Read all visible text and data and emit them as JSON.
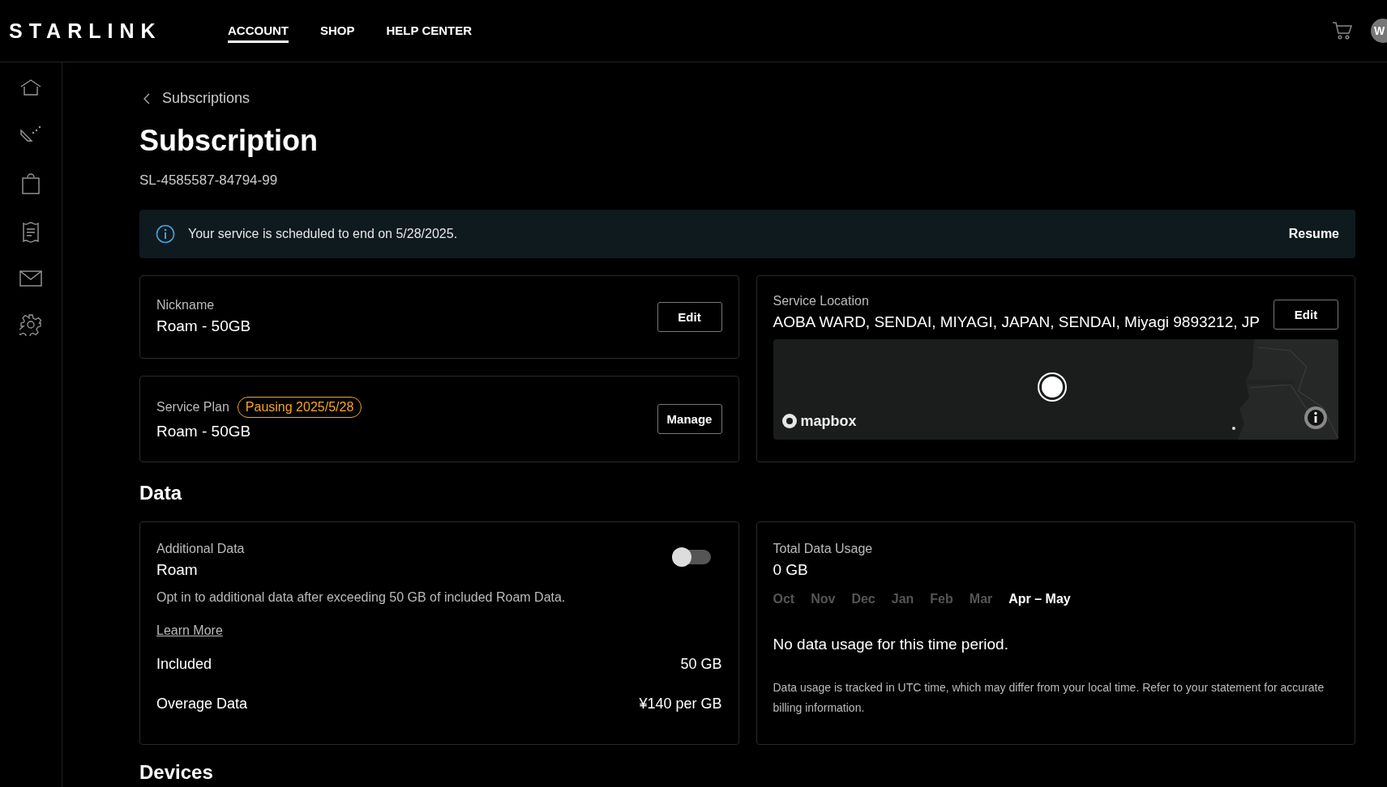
{
  "header": {
    "logo": "STARLINK",
    "nav": [
      {
        "label": "ACCOUNT",
        "selected": true
      },
      {
        "label": "SHOP",
        "selected": false
      },
      {
        "label": "HELP CENTER",
        "selected": false
      }
    ],
    "avatar": "W"
  },
  "breadcrumb": "Subscriptions",
  "title": "Subscription",
  "subscription_id": "SL-4585587-84794-99",
  "banner": {
    "message": "Your service is scheduled to end on 5/28/2025.",
    "action": "Resume"
  },
  "nickname": {
    "label": "Nickname",
    "value": "Roam - 50GB",
    "button": "Edit"
  },
  "service_plan": {
    "label": "Service Plan",
    "badge": "Pausing 2025/5/28",
    "value": "Roam - 50GB",
    "button": "Manage"
  },
  "service_location": {
    "label": "Service Location",
    "value": "AOBA WARD, SENDAI, MIYAGI, JAPAN, SENDAI, Miyagi 9893212, JP",
    "button": "Edit",
    "map": {
      "kind": "picture",
      "attribution": "mapbox"
    }
  },
  "data_heading": "Data",
  "additional_data": {
    "label": "Additional Data",
    "value": "Roam",
    "on": false,
    "description": "Opt in to additional data after exceeding 50 GB of included Roam Data.",
    "link": "Learn More",
    "rows": [
      {
        "label": "Included",
        "value": "50 GB"
      },
      {
        "label": "Overage Data",
        "value": "¥140 per GB"
      }
    ]
  },
  "usage": {
    "label": "Total Data Usage",
    "value": "0 GB",
    "periods": [
      {
        "label": "Oct",
        "selected": false
      },
      {
        "label": "Nov",
        "selected": false
      },
      {
        "label": "Dec",
        "selected": false
      },
      {
        "label": "Jan",
        "selected": false
      },
      {
        "label": "Feb",
        "selected": false
      },
      {
        "label": "Mar",
        "selected": false
      },
      {
        "label": "Apr – May",
        "selected": true
      }
    ],
    "empty": "No data usage for this time period.",
    "note": "Data usage is tracked in UTC time, which may differ from your local time. Refer to your statement for accurate billing information."
  },
  "devices_heading": "Devices"
}
